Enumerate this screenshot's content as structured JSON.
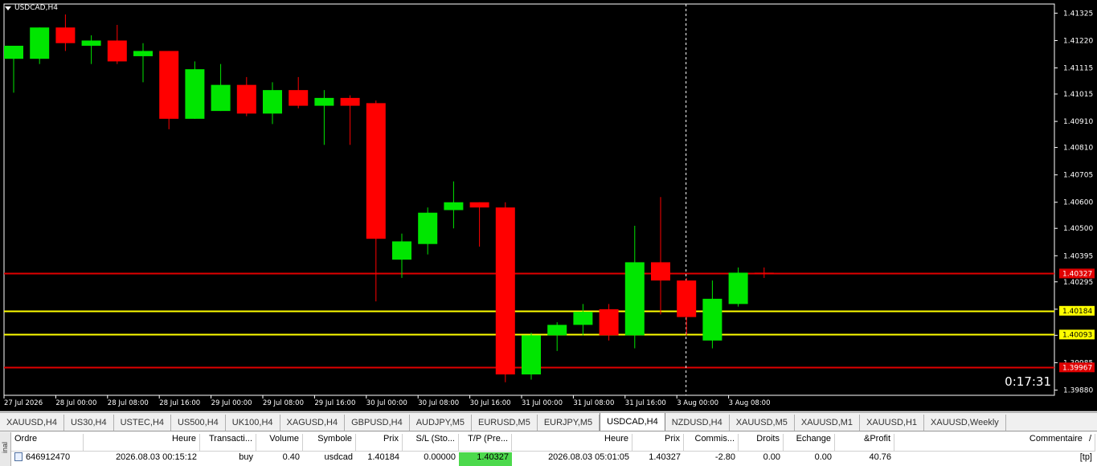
{
  "chart": {
    "title": "USDCAD,H4",
    "countdown": "0:17:31",
    "ymin": 1.3986,
    "ymax": 1.4136,
    "colors": {
      "up": "#00e600",
      "down": "#ff0000",
      "wick_up": "#00e600",
      "wick_down": "#ff0000",
      "axis_text": "#ffffff",
      "bg": "#000000"
    },
    "y_ticks": [
      "1.41325",
      "1.41220",
      "1.41115",
      "1.41015",
      "1.40910",
      "1.40810",
      "1.40705",
      "1.40600",
      "1.40500",
      "1.40395",
      "1.40295",
      "1.40190",
      "1.40090",
      "1.39985",
      "1.39880"
    ],
    "x_labels": [
      {
        "i": 0,
        "label": "27 Jul 2026"
      },
      {
        "i": 2,
        "label": "28 Jul 00:00"
      },
      {
        "i": 4,
        "label": "28 Jul 08:00"
      },
      {
        "i": 6,
        "label": "28 Jul 16:00"
      },
      {
        "i": 8,
        "label": "29 Jul 00:00"
      },
      {
        "i": 10,
        "label": "29 Jul 08:00"
      },
      {
        "i": 12,
        "label": "29 Jul 16:00"
      },
      {
        "i": 14,
        "label": "30 Jul 00:00"
      },
      {
        "i": 16,
        "label": "30 Jul 08:00"
      },
      {
        "i": 18,
        "label": "30 Jul 16:00"
      },
      {
        "i": 20,
        "label": "31 Jul 00:00"
      },
      {
        "i": 22,
        "label": "31 Jul 08:00"
      },
      {
        "i": 24,
        "label": "31 Jul 16:00"
      },
      {
        "i": 26,
        "label": "3 Aug 00:00"
      },
      {
        "i": 28,
        "label": "3 Aug 08:00"
      }
    ],
    "levels": [
      {
        "price": 1.40327,
        "label": "1.40327",
        "color": "#e00000",
        "text": "#ffffff"
      },
      {
        "price": 1.40184,
        "label": "1.40184",
        "color": "#ffff00",
        "text": "#000000"
      },
      {
        "price": 1.40093,
        "label": "1.40093",
        "color": "#ffff00",
        "text": "#000000"
      },
      {
        "price": 1.39967,
        "label": "1.39967",
        "color": "#e00000",
        "text": "#ffffff"
      }
    ],
    "candles": [
      [
        1.4115,
        1.412,
        1.4102,
        1.412
      ],
      [
        1.4115,
        1.4127,
        1.4113,
        1.4127
      ],
      [
        1.4127,
        1.4132,
        1.4118,
        1.4121
      ],
      [
        1.412,
        1.4124,
        1.4113,
        1.4122
      ],
      [
        1.4122,
        1.4128,
        1.4113,
        1.4114
      ],
      [
        1.4116,
        1.4121,
        1.4106,
        1.4118
      ],
      [
        1.4118,
        1.4118,
        1.4088,
        1.4092
      ],
      [
        1.4092,
        1.4114,
        1.4092,
        1.4111
      ],
      [
        1.4095,
        1.4113,
        1.4095,
        1.4105
      ],
      [
        1.4105,
        1.4108,
        1.4093,
        1.4094
      ],
      [
        1.4094,
        1.4106,
        1.409,
        1.4103
      ],
      [
        1.4103,
        1.4108,
        1.4096,
        1.4097
      ],
      [
        1.4097,
        1.4103,
        1.4082,
        1.41
      ],
      [
        1.41,
        1.4101,
        1.4082,
        1.4097
      ],
      [
        1.4098,
        1.4099,
        1.4022,
        1.4046
      ],
      [
        1.4038,
        1.4048,
        1.4031,
        1.4045
      ],
      [
        1.4044,
        1.4058,
        1.404,
        1.4056
      ],
      [
        1.4057,
        1.4068,
        1.405,
        1.406
      ],
      [
        1.406,
        1.406,
        1.4043,
        1.4058
      ],
      [
        1.4058,
        1.406,
        1.3991,
        1.3994
      ],
      [
        1.3994,
        1.401,
        1.3992,
        1.4009
      ],
      [
        1.4009,
        1.4014,
        1.4003,
        1.4013
      ],
      [
        1.4013,
        1.4021,
        1.4009,
        1.4018
      ],
      [
        1.4019,
        1.4021,
        1.4007,
        1.4009
      ],
      [
        1.4009,
        1.4051,
        1.4004,
        1.4037
      ],
      [
        1.4037,
        1.4062,
        1.4017,
        1.403
      ],
      [
        1.403,
        1.4031,
        1.4009,
        1.4016
      ],
      [
        1.4007,
        1.403,
        1.4004,
        1.4023
      ],
      [
        1.4021,
        1.4035,
        1.402,
        1.4033
      ],
      [
        1.4033,
        1.4035,
        1.4031,
        1.40327
      ]
    ]
  },
  "tabs": [
    "XAUUSD,H4",
    "US30,H4",
    "USTEC,H4",
    "US500,H4",
    "UK100,H4",
    "XAGUSD,H4",
    "GBPUSD,H4",
    "AUDJPY,M5",
    "EURUSD,M5",
    "EURJPY,M5",
    "USDCAD,H4",
    "NZDUSD,H4",
    "XAUUSD,M5",
    "XAUUSD,M1",
    "XAUUSD,H1",
    "XAUUSD,Weekly"
  ],
  "active_tab": 10,
  "terminal": {
    "side_label": "inal",
    "headers": [
      "Ordre",
      "Heure",
      "Transacti...",
      "Volume",
      "Symbole",
      "Prix",
      "S/L (Sto...",
      "T/P (Pre...",
      "Heure",
      "Prix",
      "Commis...",
      "Droits",
      "Echange",
      "&Profit",
      "Commentaire"
    ],
    "sort_indicator": "/",
    "row": [
      "646912470",
      "2026.08.03 00:15:12",
      "buy",
      "0.40",
      "usdcad",
      "1.40184",
      "0.00000",
      "1.40327",
      "2026.08.03 05:01:05",
      "1.40327",
      "-2.80",
      "0.00",
      "0.00",
      "40.76",
      "[tp]"
    ]
  }
}
